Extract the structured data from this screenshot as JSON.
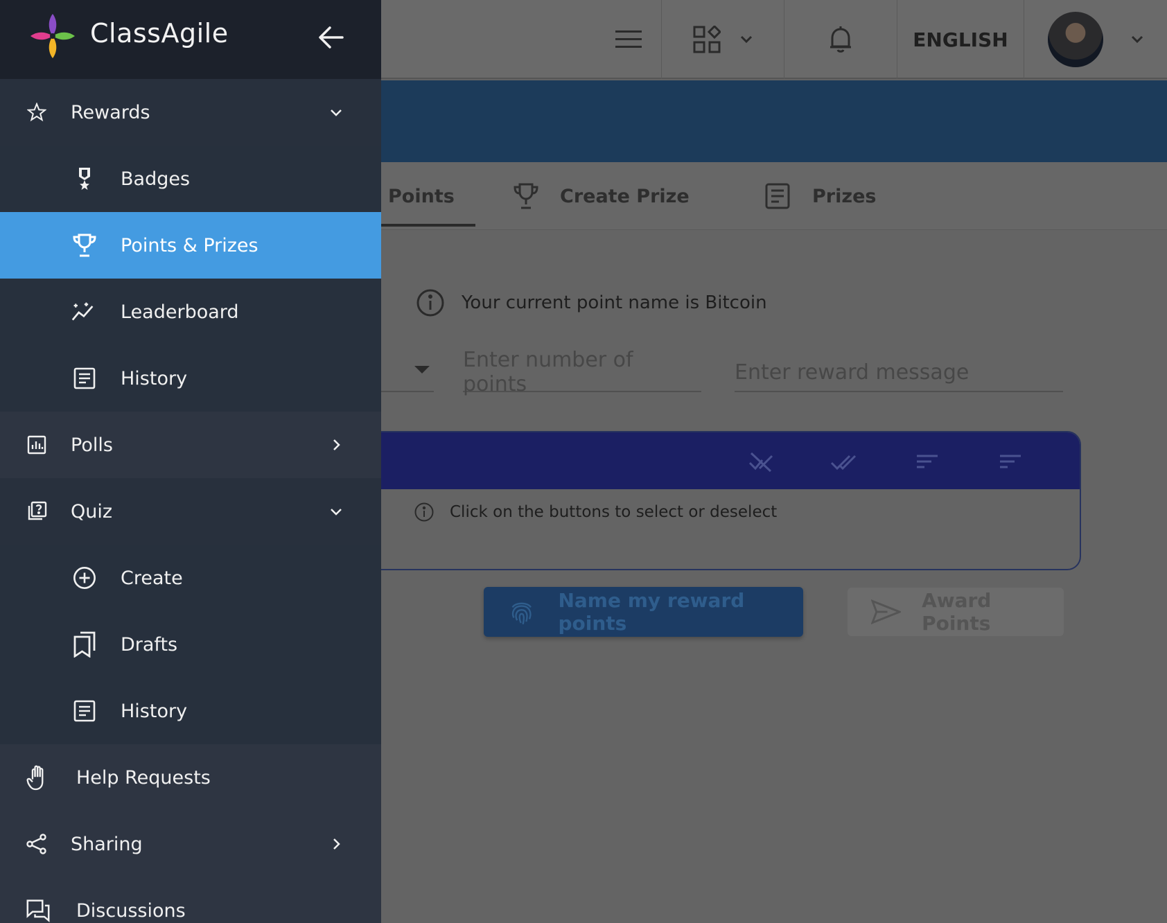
{
  "brand": {
    "name": "ClassAgile"
  },
  "topbar": {
    "language": "ENGLISH"
  },
  "tabs": [
    {
      "label": "Points"
    },
    {
      "label": "Create Prize"
    },
    {
      "label": "Prizes"
    }
  ],
  "points_form": {
    "info_text": "Your current point name is Bitcoin",
    "points_placeholder": "Enter number of points",
    "message_placeholder": "Enter reward message",
    "selection_hint": "Click on the buttons to select or deselect",
    "name_button": "Name my reward points",
    "award_button": "Award Points"
  },
  "sidebar": {
    "rewards": {
      "label": "Rewards",
      "icon": "star-icon"
    },
    "badges": {
      "label": "Badges",
      "icon": "badge-icon"
    },
    "points_prizes": {
      "label": "Points & Prizes",
      "icon": "trophy-icon"
    },
    "leaderboard": {
      "label": "Leaderboard",
      "icon": "chart-sparkle-icon"
    },
    "rewards_history": {
      "label": "History",
      "icon": "list-doc-icon"
    },
    "polls": {
      "label": "Polls",
      "icon": "poll-icon"
    },
    "quiz": {
      "label": "Quiz",
      "icon": "quiz-icon"
    },
    "quiz_create": {
      "label": "Create",
      "icon": "plus-circle-icon"
    },
    "quiz_drafts": {
      "label": "Drafts",
      "icon": "bookmarks-icon"
    },
    "quiz_history": {
      "label": "History",
      "icon": "list-doc-icon"
    },
    "help_requests": {
      "label": "Help Requests",
      "icon": "hand-icon"
    },
    "sharing": {
      "label": "Sharing",
      "icon": "share-icon"
    },
    "discussions": {
      "label": "Discussions",
      "icon": "chat-icon"
    }
  },
  "colors": {
    "sidebar_bg": "#27303d",
    "active_item": "#449be1",
    "banner": "#1c3b5a",
    "panel_head": "#1b1f63"
  }
}
